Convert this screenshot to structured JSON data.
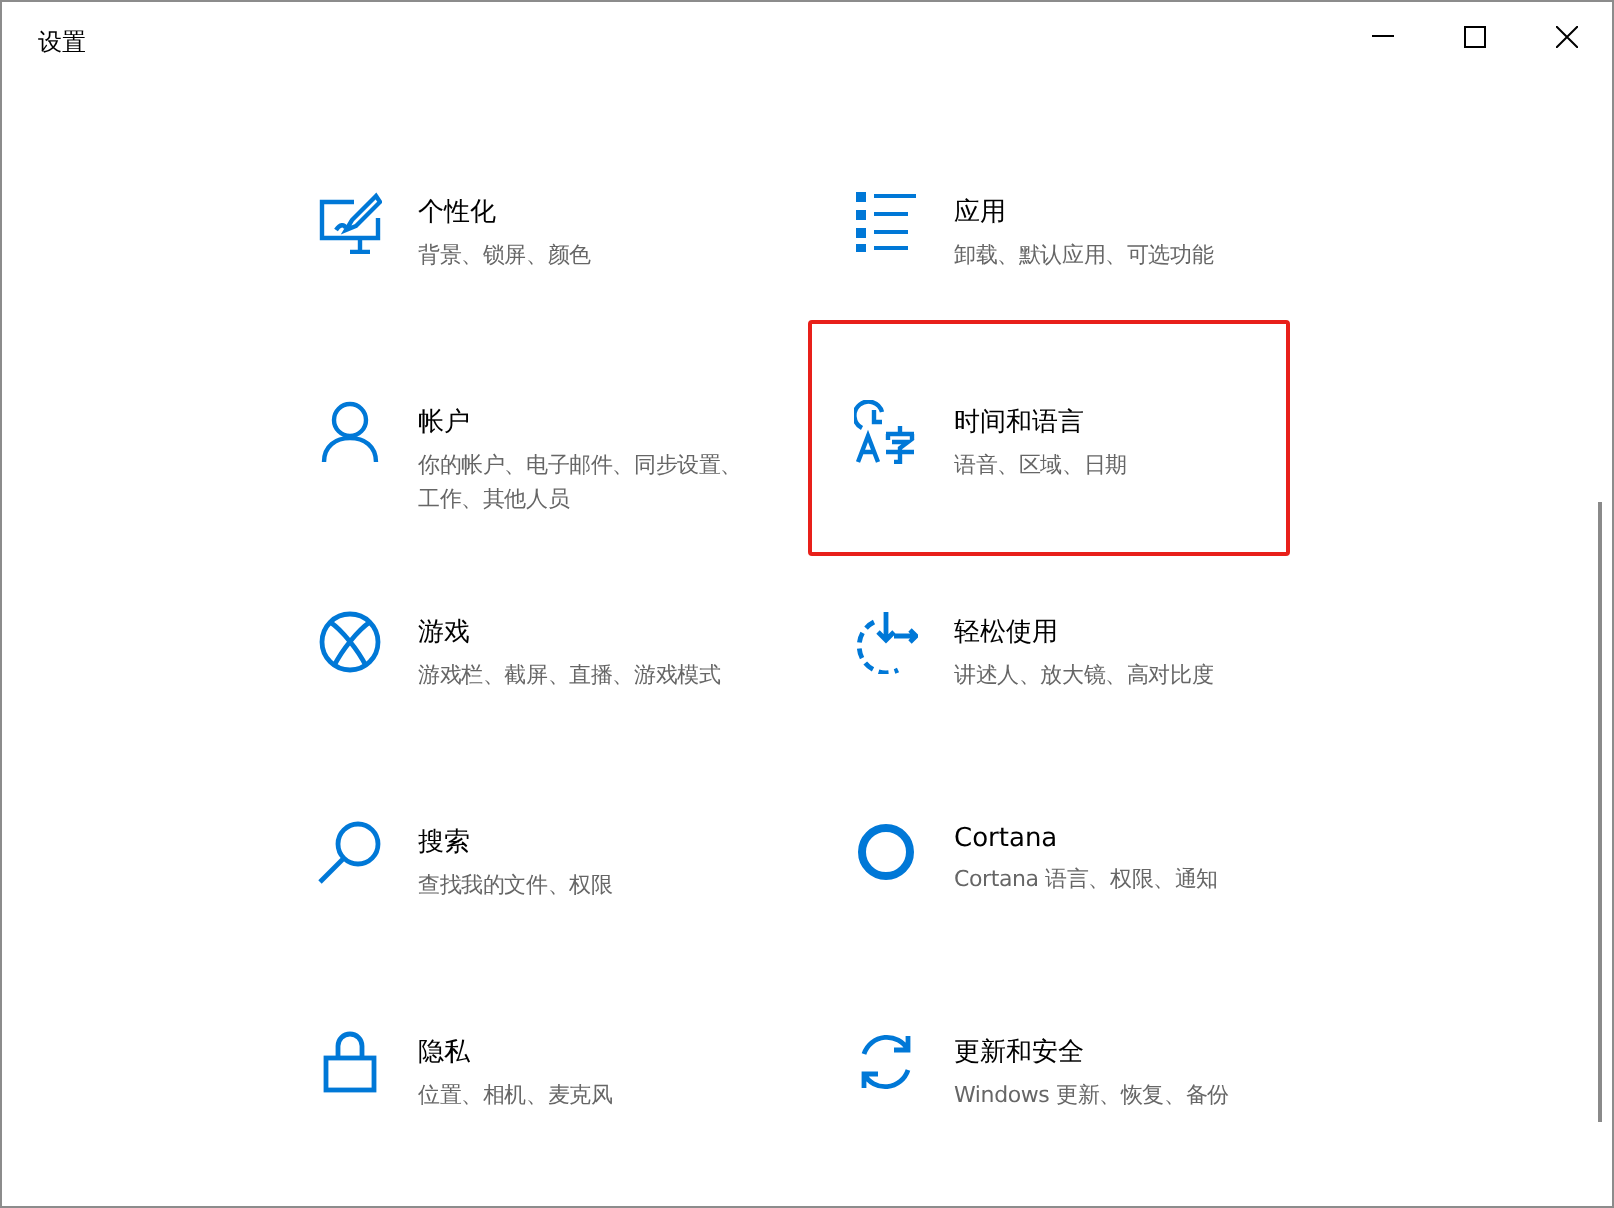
{
  "window": {
    "title": "设置"
  },
  "tiles": [
    {
      "kind": "personalization",
      "title": "个性化",
      "subtitle": "背景、锁屏、颜色",
      "highlighted": false
    },
    {
      "kind": "apps",
      "title": "应用",
      "subtitle": "卸载、默认应用、可选功能",
      "highlighted": false
    },
    {
      "kind": "account",
      "title": "帐户",
      "subtitle": "你的帐户、电子邮件、同步设置、工作、其他人员",
      "highlighted": false
    },
    {
      "kind": "time",
      "title": "时间和语言",
      "subtitle": "语音、区域、日期",
      "highlighted": true
    },
    {
      "kind": "gaming",
      "title": "游戏",
      "subtitle": "游戏栏、截屏、直播、游戏模式",
      "highlighted": false
    },
    {
      "kind": "ease",
      "title": "轻松使用",
      "subtitle": "讲述人、放大镜、高对比度",
      "highlighted": false
    },
    {
      "kind": "search",
      "title": "搜索",
      "subtitle": "查找我的文件、权限",
      "highlighted": false
    },
    {
      "kind": "cortana",
      "title": "Cortana",
      "subtitle": "Cortana 语言、权限、通知",
      "highlighted": false
    },
    {
      "kind": "privacy",
      "title": "隐私",
      "subtitle": "位置、相机、麦克风",
      "highlighted": false
    },
    {
      "kind": "update",
      "title": "更新和安全",
      "subtitle": "Windows 更新、恢复、备份",
      "highlighted": false
    }
  ]
}
